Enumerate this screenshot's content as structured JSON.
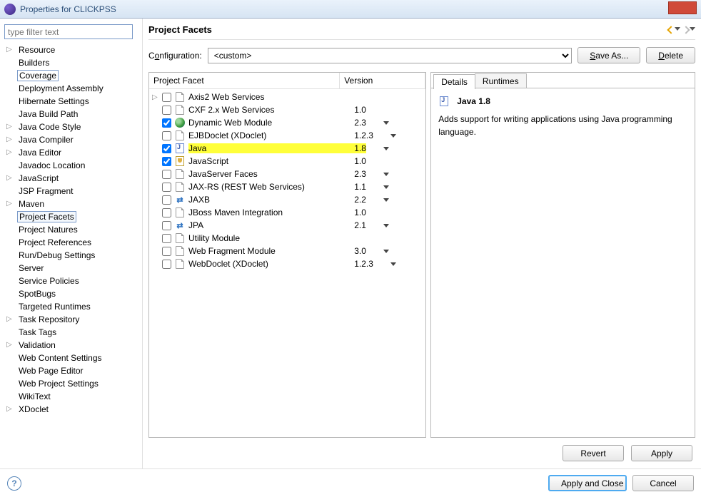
{
  "window": {
    "title": "Properties for CLICKPSS"
  },
  "filter": {
    "placeholder": "type filter text"
  },
  "sidebar": {
    "items": [
      {
        "label": "Resource",
        "group": true
      },
      {
        "label": "Builders"
      },
      {
        "label": "Coverage",
        "box": true
      },
      {
        "label": "Deployment Assembly"
      },
      {
        "label": "Hibernate Settings"
      },
      {
        "label": "Java Build Path"
      },
      {
        "label": "Java Code Style",
        "group": true
      },
      {
        "label": "Java Compiler",
        "group": true
      },
      {
        "label": "Java Editor",
        "group": true
      },
      {
        "label": "Javadoc Location"
      },
      {
        "label": "JavaScript",
        "group": true
      },
      {
        "label": "JSP Fragment"
      },
      {
        "label": "Maven",
        "group": true
      },
      {
        "label": "Project Facets",
        "selected": true
      },
      {
        "label": "Project Natures"
      },
      {
        "label": "Project References"
      },
      {
        "label": "Run/Debug Settings"
      },
      {
        "label": "Server"
      },
      {
        "label": "Service Policies"
      },
      {
        "label": "SpotBugs"
      },
      {
        "label": "Targeted Runtimes"
      },
      {
        "label": "Task Repository",
        "group": true
      },
      {
        "label": "Task Tags"
      },
      {
        "label": "Validation",
        "group": true
      },
      {
        "label": "Web Content Settings"
      },
      {
        "label": "Web Page Editor"
      },
      {
        "label": "Web Project Settings"
      },
      {
        "label": "WikiText"
      },
      {
        "label": "XDoclet",
        "group": true
      }
    ]
  },
  "header": {
    "title": "Project Facets"
  },
  "config": {
    "label": "Configuration:",
    "value": "<custom>",
    "saveAs": "Save As...",
    "delete": "Delete"
  },
  "facetTable": {
    "col1": "Project Facet",
    "col2": "Version",
    "rows": [
      {
        "name": "Axis2 Web Services",
        "ver": "",
        "icon": "page",
        "exp": true
      },
      {
        "name": "CXF 2.x Web Services",
        "ver": "1.0",
        "icon": "page"
      },
      {
        "name": "Dynamic Web Module",
        "ver": "2.3",
        "icon": "globe",
        "checked": true,
        "dd": true
      },
      {
        "name": "EJBDoclet (XDoclet)",
        "ver": "1.2.3",
        "icon": "page",
        "dd": true
      },
      {
        "name": "Java",
        "ver": "1.8",
        "icon": "java",
        "checked": true,
        "dd": true,
        "highlight": true
      },
      {
        "name": "JavaScript",
        "ver": "1.0",
        "icon": "js",
        "checked": true
      },
      {
        "name": "JavaServer Faces",
        "ver": "2.3",
        "icon": "page",
        "dd": true
      },
      {
        "name": "JAX-RS (REST Web Services)",
        "ver": "1.1",
        "icon": "page",
        "dd": true
      },
      {
        "name": "JAXB",
        "ver": "2.2",
        "icon": "swap",
        "dd": true
      },
      {
        "name": "JBoss Maven Integration",
        "ver": "1.0",
        "icon": "page"
      },
      {
        "name": "JPA",
        "ver": "2.1",
        "icon": "swap",
        "dd": true
      },
      {
        "name": "Utility Module",
        "ver": "",
        "icon": "page"
      },
      {
        "name": "Web Fragment Module",
        "ver": "3.0",
        "icon": "page",
        "dd": true
      },
      {
        "name": "WebDoclet (XDoclet)",
        "ver": "1.2.3",
        "icon": "page",
        "dd": true
      }
    ]
  },
  "detail": {
    "tab1": "Details",
    "tab2": "Runtimes",
    "title": "Java 1.8",
    "desc": "Adds support for writing applications using Java programming language."
  },
  "buttons": {
    "revert": "Revert",
    "apply": "Apply",
    "applyClose": "Apply and Close",
    "cancel": "Cancel"
  }
}
